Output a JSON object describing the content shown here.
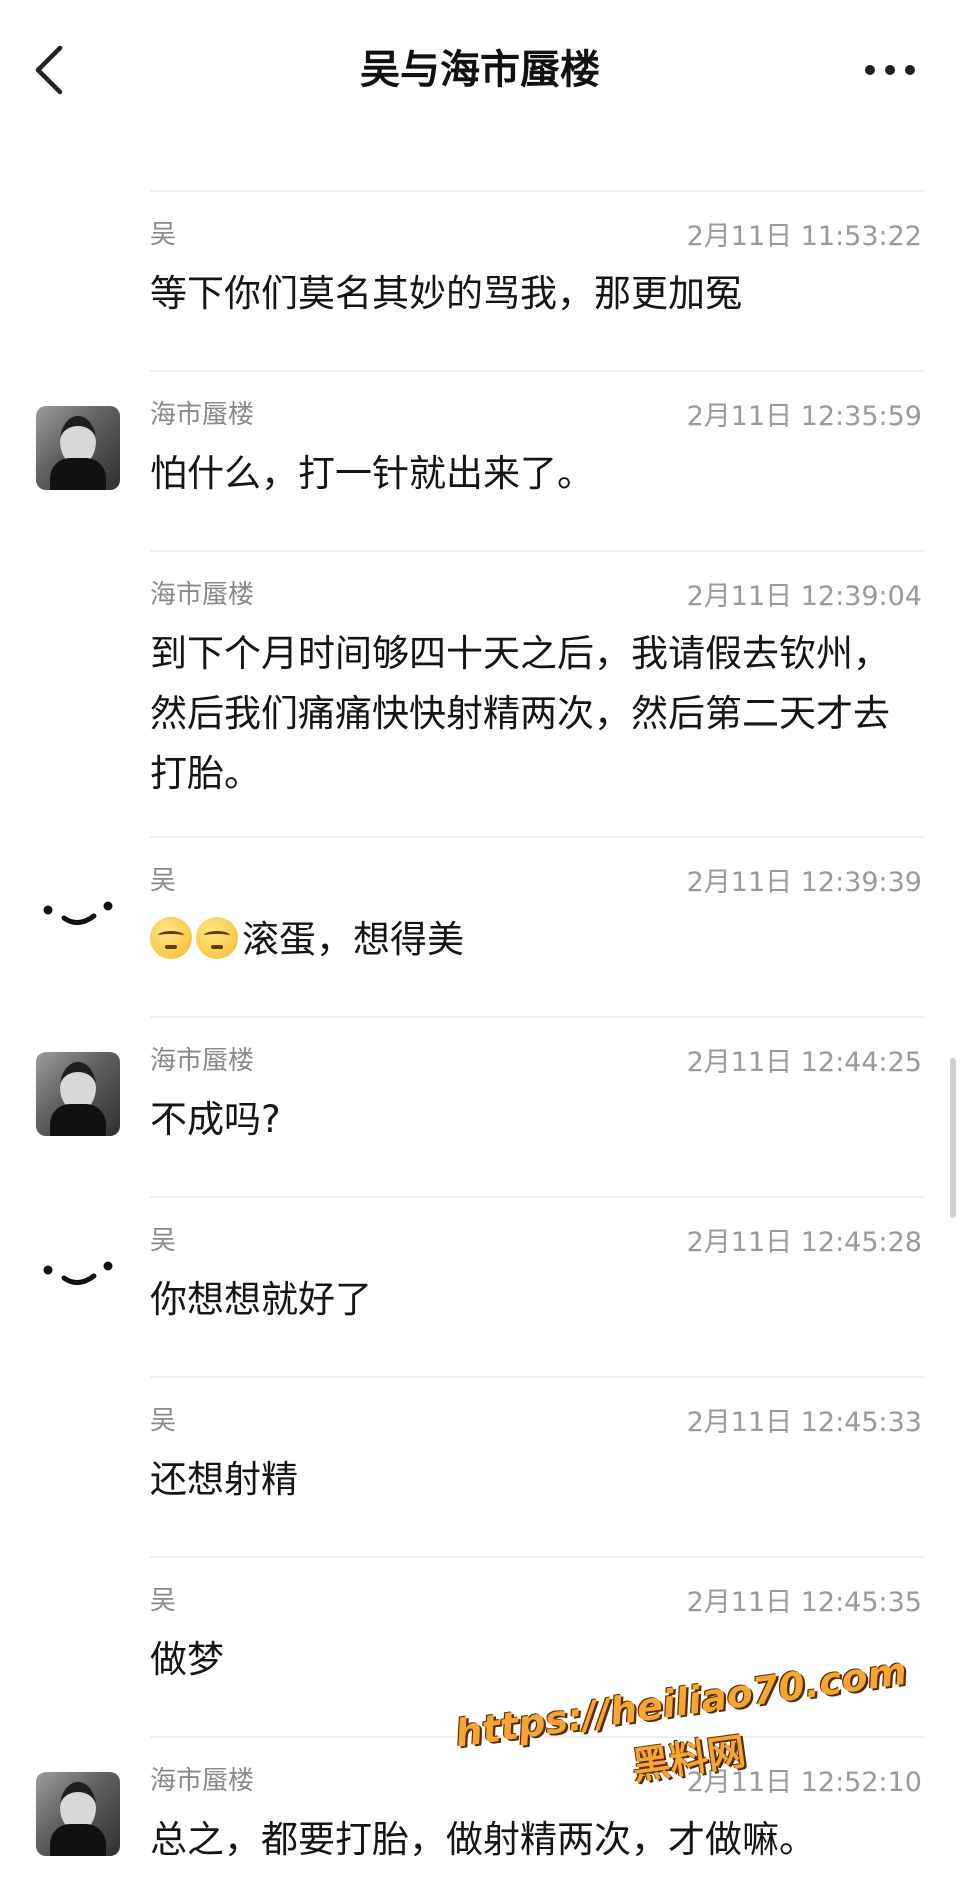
{
  "header": {
    "title": "吴与海市蜃楼",
    "back_icon": "chevron-left-icon",
    "more_icon": "more-horizontal-icon"
  },
  "messages": [
    {
      "sender": "",
      "time": "",
      "text": "怕",
      "avatar": "none"
    },
    {
      "sender": "吴",
      "time": "2月11日 11:53:22",
      "text": "等下你们莫名其妙的骂我，那更加冤",
      "avatar": "none"
    },
    {
      "sender": "海市蜃楼",
      "time": "2月11日 12:35:59",
      "text": "怕什么，打一针就出来了。",
      "avatar": "photo"
    },
    {
      "sender": "海市蜃楼",
      "time": "2月11日 12:39:04",
      "text": "到下个月时间够四十天之后，我请假去钦州，然后我们痛痛快快射精两次，然后第二天才去打胎。",
      "avatar": "none"
    },
    {
      "sender": "吴",
      "time": "2月11日 12:39:39",
      "text": "滚蛋，想得美",
      "avatar": "face",
      "emoji_count": 2
    },
    {
      "sender": "海市蜃楼",
      "time": "2月11日 12:44:25",
      "text": "不成吗?",
      "avatar": "photo"
    },
    {
      "sender": "吴",
      "time": "2月11日 12:45:28",
      "text": "你想想就好了",
      "avatar": "face"
    },
    {
      "sender": "吴",
      "time": "2月11日 12:45:33",
      "text": "还想射精",
      "avatar": "none"
    },
    {
      "sender": "吴",
      "time": "2月11日 12:45:35",
      "text": "做梦",
      "avatar": "none"
    },
    {
      "sender": "海市蜃楼",
      "time": "2月11日 12:52:10",
      "text": "总之，都要打胎，做射精两次，才做嘛。",
      "avatar": "photo"
    }
  ],
  "watermark": {
    "url": "https://heiliao70.com",
    "name": "黑料网"
  }
}
